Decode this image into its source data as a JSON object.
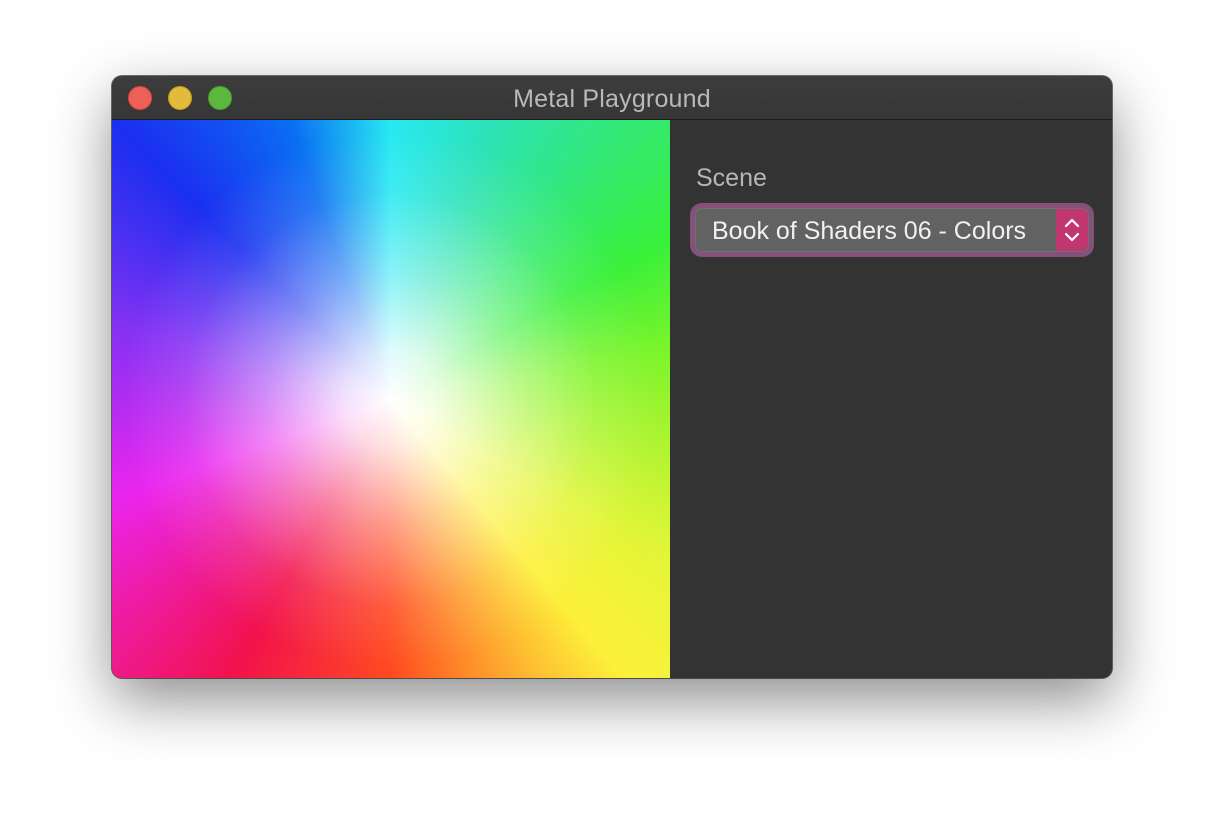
{
  "window": {
    "title": "Metal Playground",
    "controls": [
      "close",
      "minimize",
      "zoom"
    ]
  },
  "panel": {
    "scene_label": "Scene",
    "scene_select": {
      "selected": "Book of Shaders 06 - Colors",
      "icon": "up-down-chevrons-icon"
    }
  },
  "colors": {
    "close": "#ed5f57",
    "minimize": "#e2bb3c",
    "zoom": "#5cb83f",
    "accent": "#c0366e",
    "focus_ring": "#85507a"
  }
}
